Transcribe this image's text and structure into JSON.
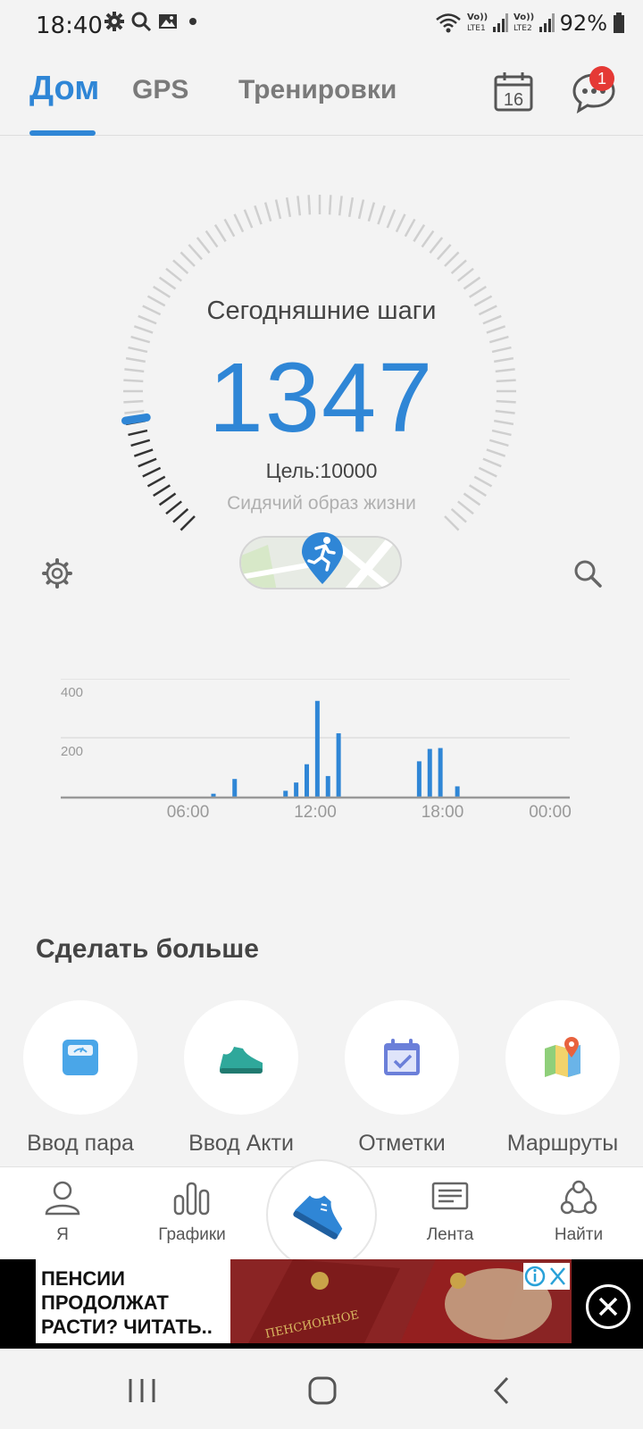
{
  "status": {
    "time": "18:40",
    "battery": "92%",
    "sim1": "LTE1",
    "sim2": "LTE2",
    "volte": "Vo))"
  },
  "nav": {
    "tabs": [
      {
        "label": "Дом",
        "active": true
      },
      {
        "label": "GPS",
        "active": false
      },
      {
        "label": "Тренировки",
        "active": false
      }
    ],
    "calendar_day": "16",
    "chat_badge": "1"
  },
  "steps": {
    "title": "Сегодняшние шаги",
    "value": "1347",
    "goal": "Цель:10000",
    "goal_value": 10000,
    "status": "Сидячий образ жизни"
  },
  "chart_data": {
    "type": "bar",
    "y_ticks": [
      "400",
      "200"
    ],
    "ylim": [
      0,
      400
    ],
    "x_ticks": [
      "06:00",
      "12:00",
      "18:00",
      "00:00"
    ],
    "bars": [
      {
        "hour": 7.2,
        "value": 10
      },
      {
        "hour": 8.2,
        "value": 60
      },
      {
        "hour": 10.6,
        "value": 20
      },
      {
        "hour": 11.1,
        "value": 48
      },
      {
        "hour": 11.6,
        "value": 110
      },
      {
        "hour": 12.1,
        "value": 325
      },
      {
        "hour": 12.6,
        "value": 70
      },
      {
        "hour": 13.1,
        "value": 215
      },
      {
        "hour": 16.9,
        "value": 120
      },
      {
        "hour": 17.4,
        "value": 162
      },
      {
        "hour": 17.9,
        "value": 165
      },
      {
        "hour": 18.7,
        "value": 35
      }
    ],
    "color": "#2f86d6"
  },
  "do_more": {
    "title": "Сделать больше",
    "items": [
      {
        "label": "Ввод пара",
        "icon": "scale-icon"
      },
      {
        "label": "Ввод Акти",
        "icon": "sneaker-icon"
      },
      {
        "label": "Отметки",
        "icon": "calendar-check-icon"
      },
      {
        "label": "Маршруты",
        "icon": "map-pin-icon"
      }
    ]
  },
  "bottom_nav": {
    "items": [
      {
        "label": "Я",
        "icon": "person-icon"
      },
      {
        "label": "Графики",
        "icon": "bar-chart-icon"
      },
      {
        "label": "",
        "icon": "shoe-icon"
      },
      {
        "label": "Лента",
        "icon": "feed-icon"
      },
      {
        "label": "Найти",
        "icon": "network-icon"
      }
    ]
  },
  "ad": {
    "text": "ПЕНСИИ ПРОДОЛЖАТ РАСТИ? ЧИТАТЬ.."
  },
  "colors": {
    "accent": "#2f86d6",
    "background": "#f3f3f3",
    "badge": "#e53935"
  }
}
